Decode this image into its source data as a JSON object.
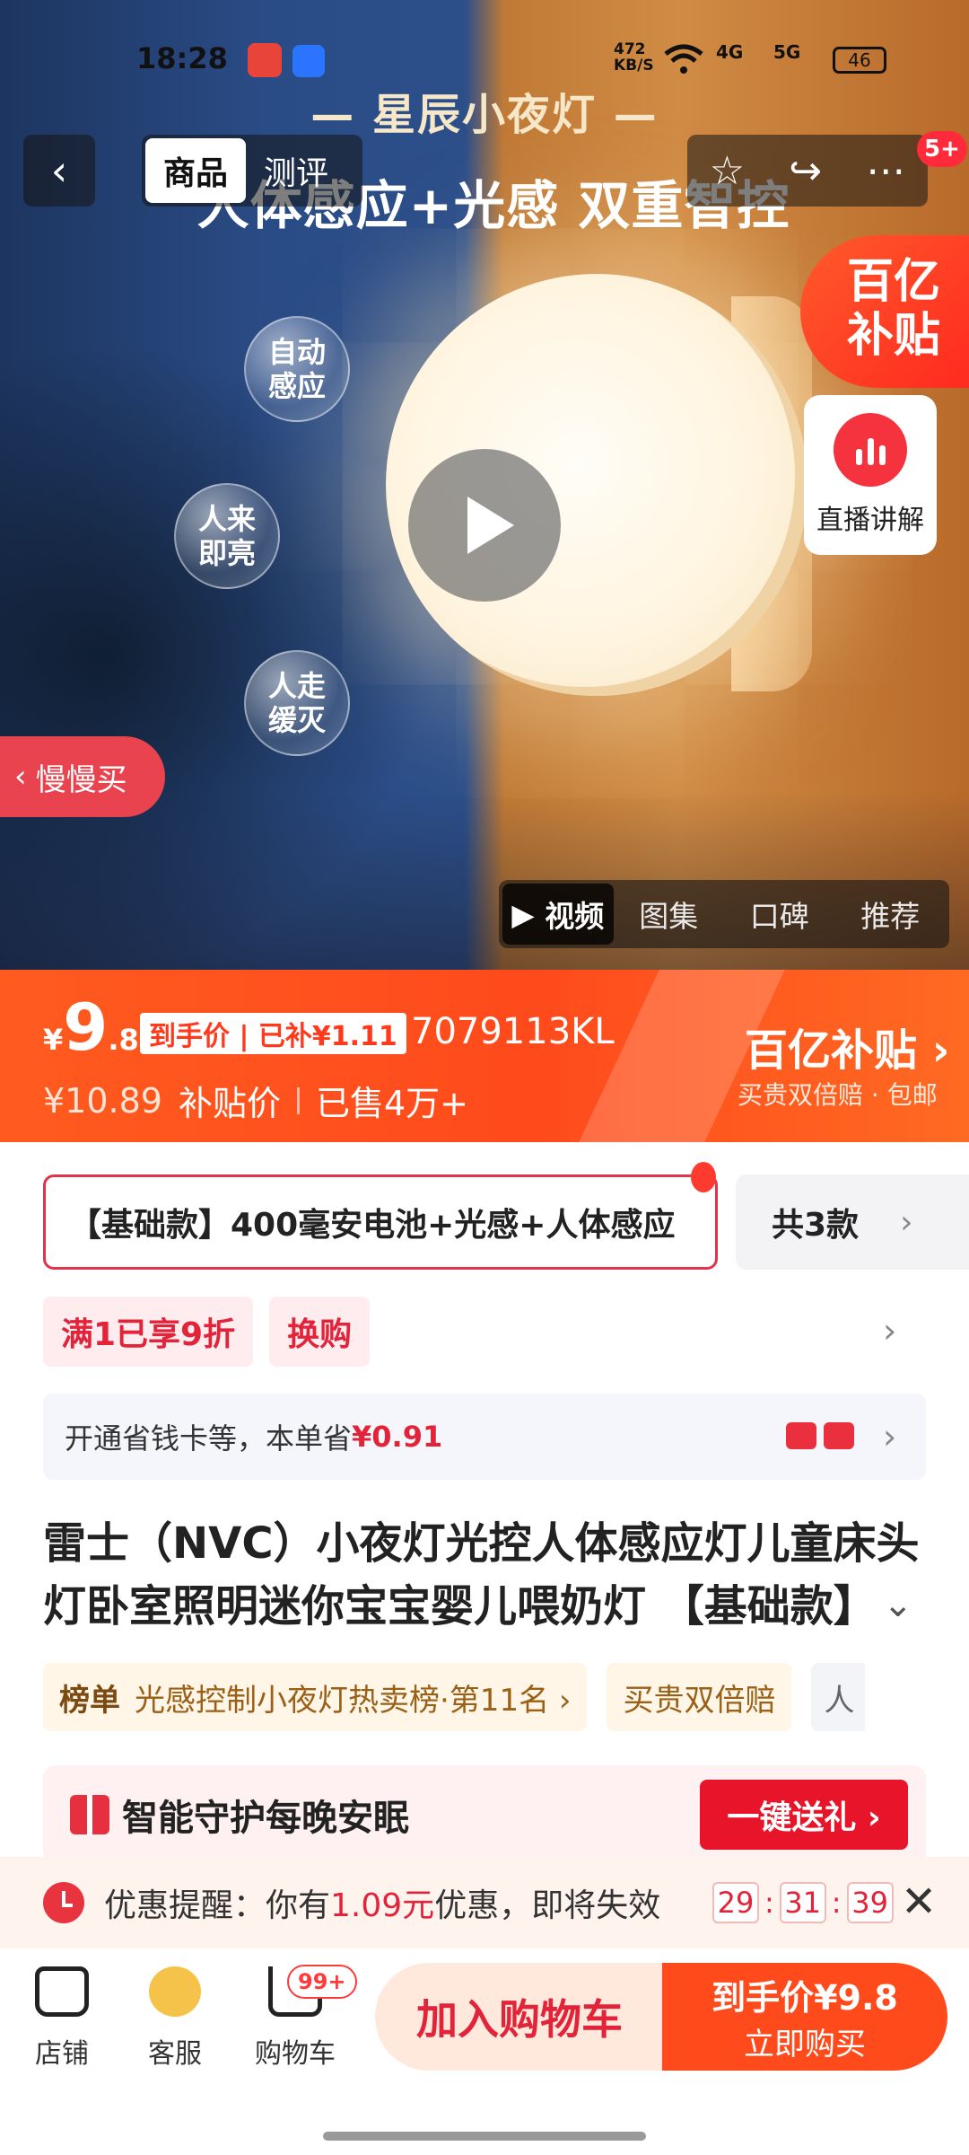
{
  "status_bar": {
    "time": "18:28",
    "net_speed": "472\nKB/S",
    "net1": "4G",
    "net2": "5G",
    "battery": "46"
  },
  "hero": {
    "title_small": "— 星辰小夜灯 —",
    "title_big": "人体感应+光感 双重智控",
    "bubbles": [
      "自动\n感应",
      "人来\n即亮",
      "人走\n缓灭"
    ]
  },
  "nav": {
    "back_icon": "chevron-left-icon",
    "tabs": [
      "商品",
      "测评"
    ],
    "badge": "5+"
  },
  "subsidy_corner": "百亿\n补贴",
  "live": {
    "label": "直播讲解"
  },
  "slow_buy": {
    "label": "慢慢买"
  },
  "media_tabs": [
    "视频",
    "图集",
    "口碑",
    "推荐"
  ],
  "price": {
    "currency": "¥",
    "integer": "9",
    "decimal": ".8",
    "tag": "到手价 | 已补¥1.11",
    "code": "7079113KL",
    "original": "¥10.89",
    "subsidy_label": "补贴价",
    "sold": "已售4万+",
    "brand_logo": "百亿补贴",
    "brand_sub": "买贵双倍赔 · 包邮"
  },
  "spec": {
    "selected": "【基础款】400毫安电池+光感+人体感应",
    "count": "共3款"
  },
  "promos": [
    "满1已享9折",
    "换购"
  ],
  "card_saving": {
    "prefix": "开通省钱卡等，本单省",
    "amount": "¥0.91"
  },
  "title": "雷士（NVC）小夜灯光控人体感应灯儿童床头灯卧室照明迷你宝宝婴儿喂奶灯 【基础款】",
  "rank": {
    "label": "榜单",
    "text": "光感控制小夜灯热卖榜·第11名 ›",
    "tag2": "买贵双倍赔",
    "more": "人"
  },
  "gift": {
    "text": "智能守护每晚安眠",
    "button": "一键送礼 ›"
  },
  "reminder": {
    "prefix": "优惠提醒：你有",
    "amount": "1.09元",
    "suffix": "优惠，即将失效",
    "timer": [
      "29",
      "31",
      "39"
    ]
  },
  "bottom": {
    "shop": "店铺",
    "service": "客服",
    "cart": "购物车",
    "cart_badge": "99+",
    "add_cart": "加入购物车",
    "buy_line1": "到手价¥9.8",
    "buy_line2": "立即购买"
  },
  "colors": {
    "accent": "#ff4a1c",
    "red": "#e2233a"
  }
}
